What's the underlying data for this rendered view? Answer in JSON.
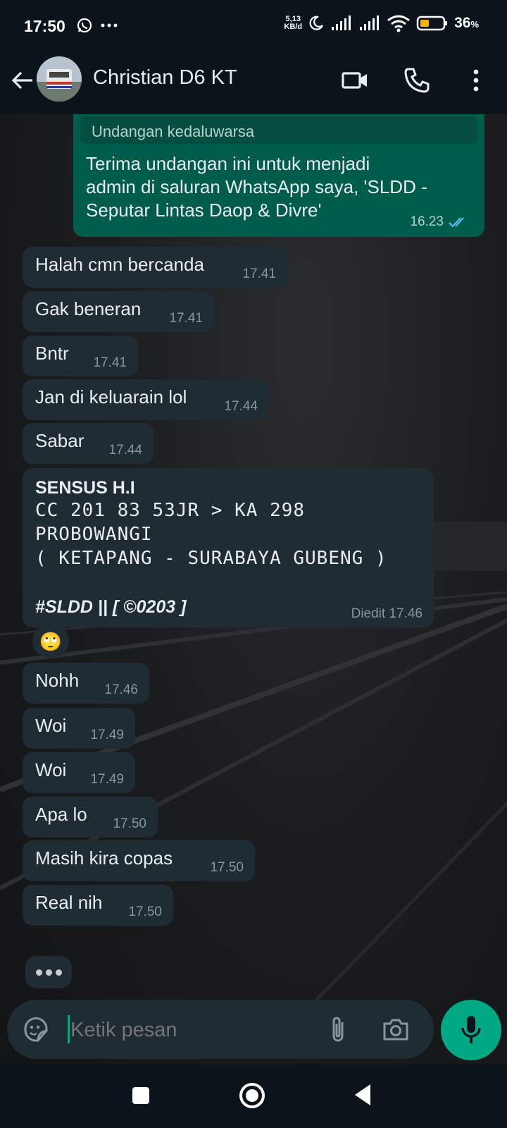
{
  "status_bar": {
    "time": "17:50",
    "net_speed_value": "5,13",
    "net_speed_unit": "KB/d",
    "battery_percent": "36",
    "battery_unit": "%"
  },
  "header": {
    "contact_name": "Christian D6 KT",
    "icons": [
      "back-arrow-icon",
      "video-call-icon",
      "phone-icon",
      "more-vertical-icon"
    ]
  },
  "messages": {
    "outgoing_invite": {
      "quote": "Undangan kedaluwarsa",
      "line1": "Terima undangan ini untuk menjadi",
      "line2": "admin di saluran WhatsApp saya, 'SLDD -",
      "line3": "Seputar Lintas Daop & Divre'",
      "time": "16.23",
      "read_color": "#53bdeb"
    },
    "incoming": [
      {
        "text": "Halah cmn bercanda",
        "time": "17.41"
      },
      {
        "text": "Gak beneran",
        "time": "17.41"
      },
      {
        "text": "Bntr",
        "time": "17.41"
      },
      {
        "text": "Jan di keluarain lol",
        "time": "17.44"
      },
      {
        "text": "Sabar",
        "time": "17.44"
      }
    ],
    "sensus": {
      "title": "SENSUS H.I",
      "line1": "CC 201 83 53JR > KA 298",
      "line2": "PROBOWANGI",
      "line3": "( KETAPANG - SURABAYA GUBENG )",
      "tag": "#SLDD || [ ©0203 ]",
      "edited": "Diedit 17.46",
      "reaction": "🙄"
    },
    "incoming_after": [
      {
        "text": "Nohh",
        "time": "17.46"
      },
      {
        "text": "Woi",
        "time": "17.49"
      },
      {
        "text": "Woi",
        "time": "17.49"
      },
      {
        "text": "Apa lo",
        "time": "17.50"
      },
      {
        "text": "Masih kira copas",
        "time": "17.50"
      },
      {
        "text": "Real nih",
        "time": "17.50"
      }
    ]
  },
  "composer": {
    "placeholder": "Ketik pesan",
    "icons": [
      "sticker-icon",
      "attach-icon",
      "camera-icon",
      "mic-icon"
    ]
  },
  "colors": {
    "accent": "#00a884",
    "bubble_in": "#202c33",
    "bubble_out": "#005c4b",
    "bar": "#0b141a"
  }
}
